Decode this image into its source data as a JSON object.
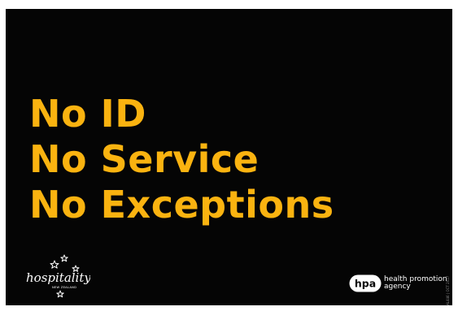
{
  "poster": {
    "headline_lines": [
      "No ID",
      "No Service",
      "No Exceptions"
    ],
    "colors": {
      "background": "#050505",
      "headline": "#fab310",
      "logo": "#ffffff"
    }
  },
  "logos": {
    "hospitality": {
      "wordmark": "hospitality",
      "tagline": "NEW ZEALAND",
      "icon": "stars-icon"
    },
    "hpa": {
      "mark": "hpa",
      "line1": "health promotion",
      "line2": "agency"
    }
  },
  "reference_code": "AL446 | OCT 2017"
}
